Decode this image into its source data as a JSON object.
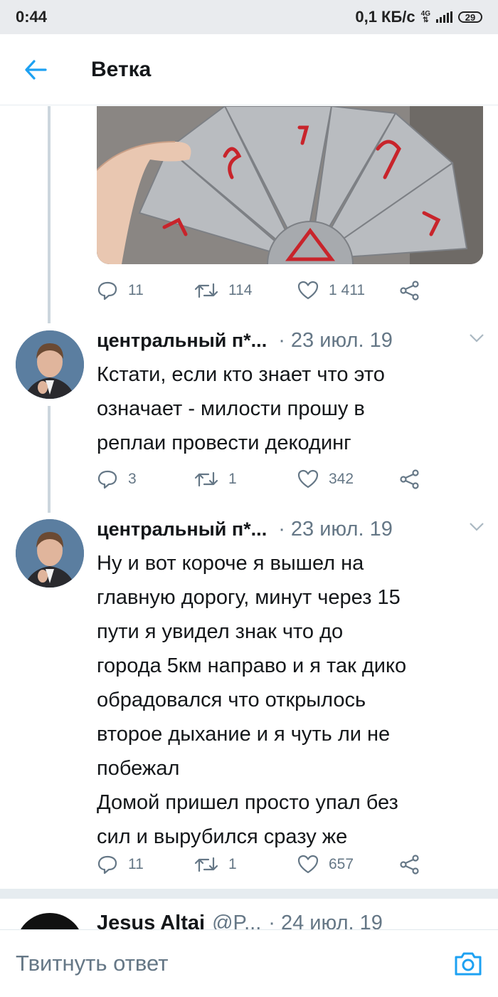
{
  "status": {
    "time": "0:44",
    "speed": "0,1 КБ/с",
    "network": "4G",
    "battery": "29"
  },
  "header": {
    "title": "Ветка",
    "back_icon": "arrow-left-icon"
  },
  "colors": {
    "accent": "#1da1f2",
    "muted": "#657786",
    "line": "#ccd6dd"
  },
  "first_tweet_stats": {
    "replies": "11",
    "retweets": "114",
    "likes": "1 411"
  },
  "tweets": [
    {
      "name": "центральный п*...",
      "date": "· 23 июл. 19",
      "lines": [
        "Кстати, если кто знает что это",
        "означает - милости прошу в",
        "реплаи провести декодинг"
      ],
      "replies": "3",
      "retweets": "1",
      "likes": "342"
    },
    {
      "name": "центральный п*...",
      "date": "· 23 июл. 19",
      "lines": [
        "Ну и вот короче я вышел на",
        "главную дорогу, минут через 15",
        "пути я увидел знак что до",
        "города 5км направо и я так дико",
        "обрадовался что открылось",
        "второе дыхание и я чуть ли не",
        "побежал",
        "Домой пришел просто упал без",
        "сил и вырубился сразу же"
      ],
      "replies": "11",
      "retweets": "1",
      "likes": "657"
    }
  ],
  "next_tweet": {
    "name": "Jesus Altai",
    "handle": "@P...",
    "date": "· 24 июл. 19"
  },
  "reply": {
    "placeholder": "Твитнуть ответ",
    "camera_icon": "camera-icon"
  }
}
